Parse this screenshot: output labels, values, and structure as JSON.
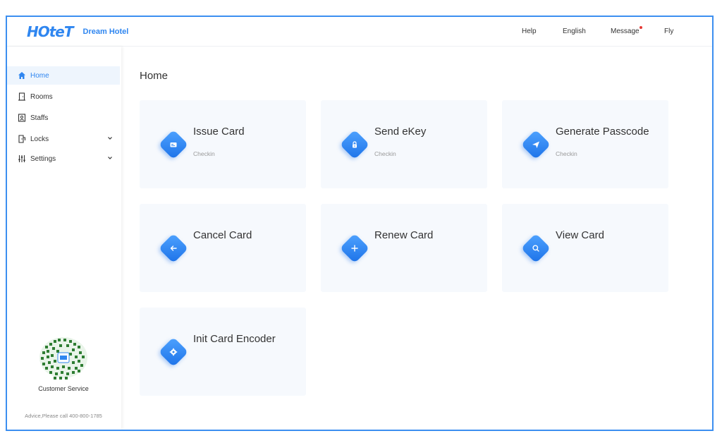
{
  "header": {
    "logo_mark": "HOteT",
    "hotel_name": "Dream Hotel",
    "nav": {
      "help": "Help",
      "english": "English",
      "message": "Message",
      "fly": "Fly"
    }
  },
  "sidebar": {
    "items": [
      {
        "label": "Home",
        "icon": "home-icon",
        "active": true
      },
      {
        "label": "Rooms",
        "icon": "door-icon"
      },
      {
        "label": "Staffs",
        "icon": "staff-icon"
      },
      {
        "label": "Locks",
        "icon": "lock-icon",
        "expandable": true
      },
      {
        "label": "Settings",
        "icon": "sliders-icon",
        "expandable": true
      }
    ],
    "customer_service": "Customer Service",
    "advice": "Advice,Please call 400-800-1785"
  },
  "main": {
    "title": "Home",
    "cards": [
      {
        "title": "Issue Card",
        "subtitle": "Checkin",
        "icon": "card-icon"
      },
      {
        "title": "Send eKey",
        "subtitle": "Checkin",
        "icon": "key-icon"
      },
      {
        "title": "Generate Passcode",
        "subtitle": "Checkin",
        "icon": "send-icon"
      },
      {
        "title": "Cancel Card",
        "subtitle": "",
        "icon": "arrow-left-icon"
      },
      {
        "title": "Renew Card",
        "subtitle": "",
        "icon": "plus-icon"
      },
      {
        "title": "View Card",
        "subtitle": "",
        "icon": "search-icon"
      },
      {
        "title": "Init Card Encoder",
        "subtitle": "",
        "icon": "gear-icon"
      }
    ]
  },
  "colors": {
    "accent": "#2f86f0",
    "card_bg": "#f6f9fd",
    "frame_border": "#3c8ff0",
    "notification_dot": "#e53935"
  }
}
